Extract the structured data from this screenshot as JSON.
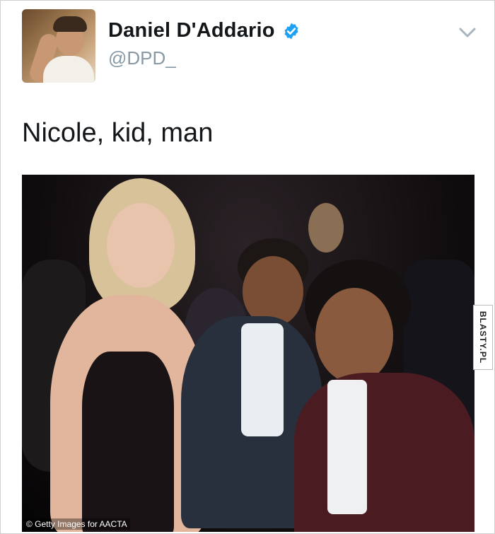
{
  "tweet": {
    "display_name": "Daniel D'Addario",
    "handle": "@DPD_",
    "text": "Nicole, kid, man",
    "verified_icon": "verified-badge-icon",
    "menu_icon": "chevron-down-icon"
  },
  "photo": {
    "credit": "© Getty Images for AACTA"
  },
  "watermark": {
    "text": "BLASTY.PL"
  },
  "colors": {
    "verified": "#1da1f2",
    "handle": "#8899a6",
    "text": "#14171a"
  }
}
